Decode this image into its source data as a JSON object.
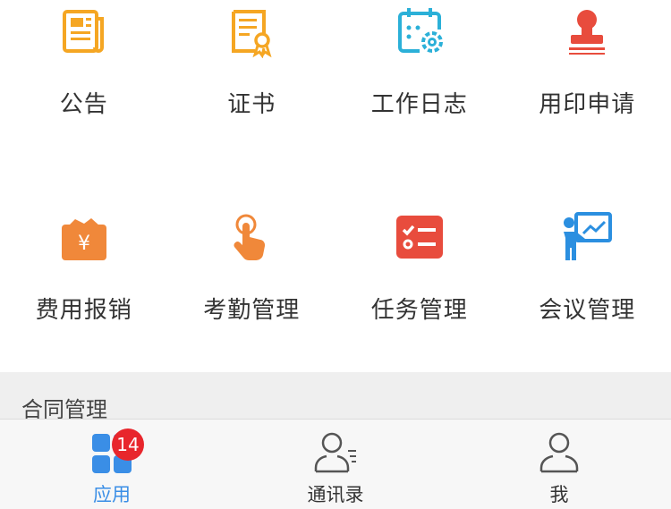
{
  "grid": {
    "row1": [
      "公告",
      "证书",
      "工作日志",
      "用印申请"
    ],
    "row2": [
      "费用报销",
      "考勤管理",
      "任务管理",
      "会议管理"
    ]
  },
  "icons": {
    "notice": "newspaper-icon",
    "certificate": "certificate-icon",
    "worklog": "calendar-gear-icon",
    "seal": "seal-stamp-icon",
    "expense": "wallet-yen-icon",
    "attendance": "hand-tap-icon",
    "task": "checklist-icon",
    "meeting": "presentation-icon"
  },
  "expense_symbol": "¥",
  "section": {
    "title": "合同管理"
  },
  "tabbar": {
    "tabs": [
      "应用",
      "通讯录",
      "我"
    ],
    "badge": "14"
  },
  "colors": {
    "accent": "#3a8ee6",
    "badge": "#e8262c",
    "orange": "#f5a623",
    "cyan": "#2bb0d8",
    "red": "#e84c3d",
    "blue": "#2b8fe0"
  }
}
